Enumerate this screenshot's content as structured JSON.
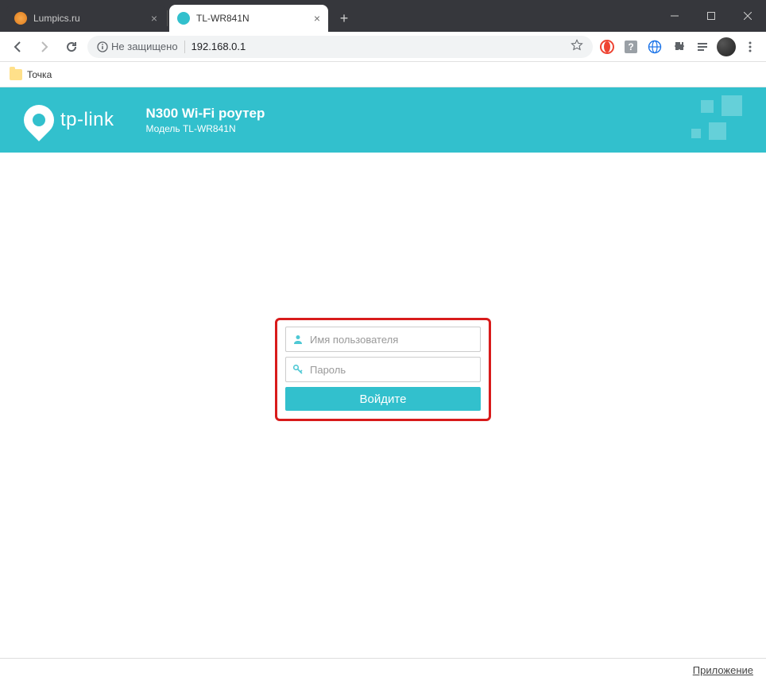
{
  "browser": {
    "tabs": [
      {
        "title": "Lumpics.ru",
        "active": false
      },
      {
        "title": "TL-WR841N",
        "active": true
      }
    ],
    "address": {
      "security_label": "Не защищено",
      "url": "192.168.0.1"
    },
    "bookmarks": [
      {
        "label": "Точка"
      }
    ]
  },
  "page": {
    "brand": "tp-link",
    "title": "N300 Wi-Fi роутер",
    "subtitle": "Модель TL-WR841N",
    "login": {
      "username_placeholder": "Имя пользователя",
      "password_placeholder": "Пароль",
      "submit_label": "Войдите"
    },
    "footer_link": "Приложение"
  },
  "colors": {
    "accent": "#32c0cd",
    "highlight": "#d81b1b"
  }
}
